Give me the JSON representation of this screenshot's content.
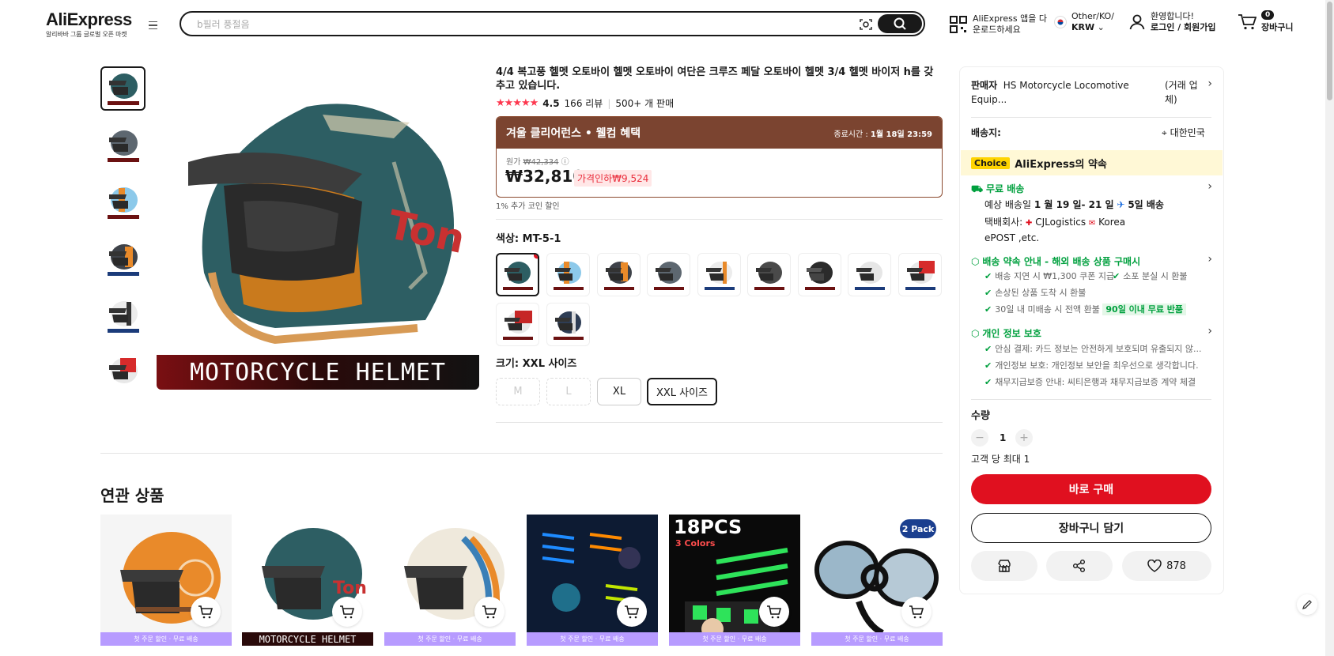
{
  "header": {
    "logo": "AliExpress",
    "logo_sub": "알리바바 그룹 글로벌 오픈 마켓",
    "search_placeholder": "b필러 풍절음",
    "app_line1": "AliExpress 앱을 다",
    "app_line2": "운로드하세요",
    "region_line1": "Other/KO/",
    "region_line2": "KRW",
    "account_line1": "환영합니다!",
    "account_line2": "로그인 / 회원가입",
    "cart_count": "0",
    "cart_label": "장바구니"
  },
  "product": {
    "title": "4/4 복고풍 헬멧 오토바이 헬멧 오토바이 여단은 크루즈 페달 오토바이 헬멧 3/4 헬멧 바이저 h를 갖추고 있습니다.",
    "rating": "4.5",
    "reviews": "166 리뷰",
    "sold": "500+ 개 판매",
    "main_image_text": "MOTORCYCLE HELMET",
    "deal_title": "겨울 클리어런스 • 웰컴 혜택",
    "deal_end_label": "종료시간 :",
    "deal_end_value": "1월 18일 23:59",
    "orig_label": "원가",
    "orig_price": "₩42,334",
    "price": "₩32,810",
    "discount": "가격인하₩9,524",
    "coin": "1% 추가 코인 할인",
    "color_label": "색상: MT-5-1",
    "size_label": "크기: XXL 사이즈",
    "sizes": [
      "M",
      "L",
      "XL",
      "XXL 사이즈"
    ]
  },
  "related": {
    "title": "연관 상품",
    "banner": "첫 주문 할인 · 무료 배송",
    "card_text_2": "MOTORCYCLE HELMET",
    "card_text_5a": "18PCS",
    "card_text_5b": "3 Colors",
    "card_text_6": "2 Pack"
  },
  "panel": {
    "seller_label": "판매자",
    "seller_name": "HS Motorcycle Locomotive Equip...",
    "seller_note": "(거래 업체)",
    "ship_to_label": "배송지:",
    "ship_to_value": "대한민국",
    "choice_tag": "Choice",
    "choice_text": "AliExpress의 약속",
    "free_ship": "무료 배송",
    "eta_prefix": "예상 배송일",
    "eta_dates": "1 월 19 일- 21 일",
    "eta_days": "5일 배송",
    "carrier_prefix": "택배회사:",
    "carrier_1": "CJLogistics",
    "carrier_2": "Korea",
    "carrier_3": "ePOST ,etc.",
    "guarantee_title": "배송 약속 안내 - 해외 배송 상품 구매시",
    "g1": "배송 지연 시 ₩1,300 쿠폰 지급",
    "g2": "소포 분실 시 환불",
    "g3": "손상된 상품 도착 시 환불",
    "g4": "30일 내 미배송 시 전액 환불",
    "g4_badge": "90일 이내 무료 반품",
    "privacy_title": "개인 정보 보호",
    "p1": "안심 결제: 카드 정보는 안전하게 보호되며 유출되지 않...",
    "p2": "개인정보 보호: 개인정보 보안을 최우선으로 생각합니다.",
    "p3": "채무지급보증 안내: 씨티은행과 채무지급보증 계약 체결",
    "qty_label": "수량",
    "qty_value": "1",
    "qty_limit": "고객 당 최대 1",
    "buy_now": "바로 구매",
    "add_cart": "장바구니 담기",
    "wish_count": "878"
  },
  "colors": {
    "brand_red": "#e0101f",
    "deal_brown": "#7b4430",
    "green": "#00a03e",
    "helmet_teal": "#2d5e63"
  }
}
